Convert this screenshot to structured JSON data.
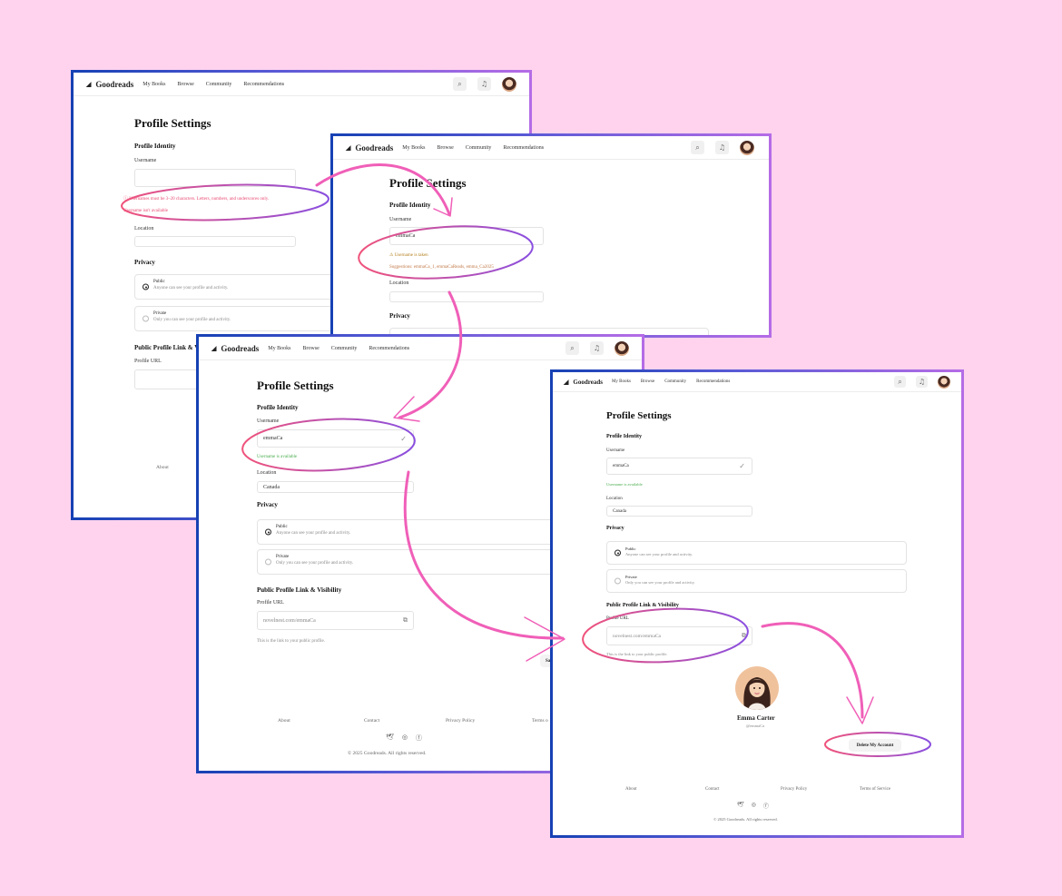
{
  "nav": {
    "brand": "Goodreads",
    "links": [
      "My Books",
      "Browse",
      "Community",
      "Recommendations"
    ]
  },
  "page_title": "Profile Settings",
  "section_identity": "Profile Identity",
  "label_username": "Username",
  "label_location": "Location",
  "section_privacy": "Privacy",
  "privacy": {
    "public_title": "Public",
    "public_desc": "Anyone can see your profile and activity.",
    "private_title": "Private",
    "private_desc": "Only you can see your profile and activity."
  },
  "section_link": "Public Profile Link & Visibility",
  "section_link_partial": "Public Profile Link & V",
  "label_url": "Profile URL",
  "url_value": "novelnest.com/emmaCa",
  "url_hint": "This is the link to your public profile.",
  "username_value": "emmaCa",
  "location_value": "Canada",
  "screen1": {
    "rule_msg": "Usernames must be 3–20 characters. Letters, numbers, and underscores only.",
    "error_msg": "Username isn't available"
  },
  "screen2": {
    "taken_msg": "Username is taken",
    "suggestions": "Suggestions: emmaCa_1, emmaCaReads, emma_Ca2025"
  },
  "available_msg": "Username is available",
  "footer": {
    "about": "About",
    "contact": "Contact",
    "privacy": "Privacy Policy",
    "terms": "Terms of Service",
    "terms_partial": "Terms o",
    "copyright": "© 2025 Goodreads. All rights reserved."
  },
  "save_partial": "Sa",
  "profile": {
    "name": "Emma Carter",
    "handle": "@emmaCa"
  },
  "delete_button": "Delete My Account",
  "icons": [
    "search-icon",
    "bell-icon",
    "twitter-icon",
    "instagram-icon",
    "facebook-icon",
    "check-icon",
    "copy-icon",
    "warning-icon",
    "info-icon"
  ],
  "colors": {
    "background": "#ffd3ee",
    "frame_start": "#1641b4",
    "frame_end": "#b56ce6",
    "annotation_pink": "#f05fb8",
    "error": "#e84a73",
    "success": "#4bae4f"
  }
}
